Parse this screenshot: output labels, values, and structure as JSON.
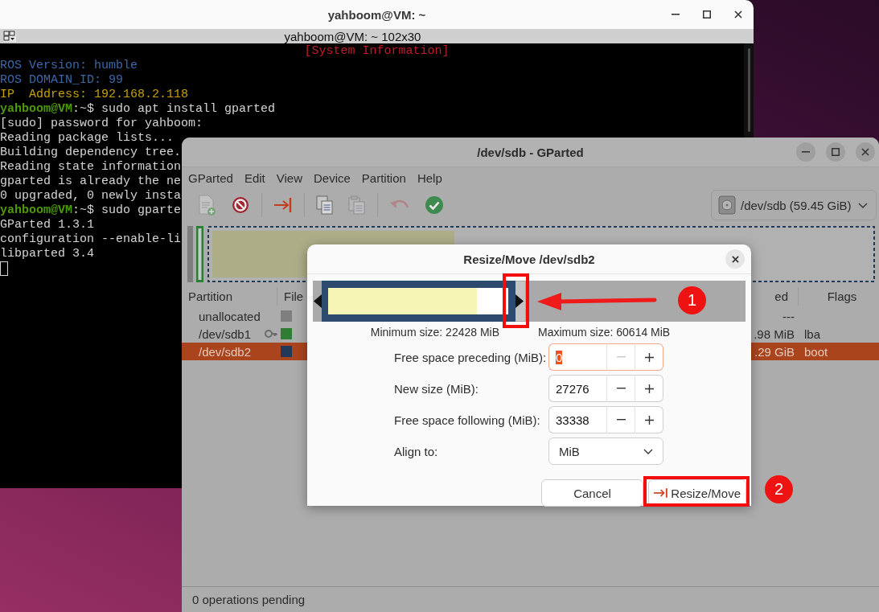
{
  "terminal": {
    "title": "yahboom@VM: ~",
    "tab_title": "yahboom@VM: ~ 102x30",
    "banner": "[System Information]",
    "cursor": true,
    "lines": [
      {
        "segments": [
          {
            "kind": "info",
            "text": "ROS Version: humble"
          }
        ]
      },
      {
        "segments": [
          {
            "kind": "info",
            "text": "ROS DOMAIN_ID: 99"
          }
        ]
      },
      {
        "segments": [
          {
            "kind": "address",
            "text": "IP  Address: 192.168.2.118"
          }
        ]
      },
      {
        "segments": [
          {
            "kind": "user",
            "text": "yahboom@VM"
          },
          {
            "kind": "plain",
            "text": ":~$ sudo apt install gparted"
          }
        ]
      },
      {
        "segments": [
          {
            "kind": "plain",
            "text": "[sudo] password for yahboom:"
          }
        ]
      },
      {
        "segments": [
          {
            "kind": "plain",
            "text": "Reading package lists..."
          }
        ]
      },
      {
        "segments": [
          {
            "kind": "plain",
            "text": "Building dependency tree."
          }
        ]
      },
      {
        "segments": [
          {
            "kind": "plain",
            "text": "Reading state information"
          }
        ]
      },
      {
        "segments": [
          {
            "kind": "plain",
            "text": "gparted is already the ne"
          }
        ]
      },
      {
        "segments": [
          {
            "kind": "plain",
            "text": "0 upgraded, 0 newly insta"
          }
        ]
      },
      {
        "segments": [
          {
            "kind": "user",
            "text": "yahboom@VM"
          },
          {
            "kind": "plain",
            "text": ":~$ sudo gparte"
          }
        ]
      },
      {
        "segments": [
          {
            "kind": "plain",
            "text": "GParted 1.3.1"
          }
        ]
      },
      {
        "segments": [
          {
            "kind": "plain",
            "text": "configuration --enable-li"
          }
        ]
      },
      {
        "segments": [
          {
            "kind": "plain",
            "text": "libparted 3.4"
          }
        ]
      }
    ]
  },
  "gparted": {
    "title": "/dev/sdb - GParted",
    "menu": [
      "GParted",
      "Edit",
      "View",
      "Device",
      "Partition",
      "Help"
    ],
    "toolbar": [
      {
        "kind": "new",
        "disabled": true
      },
      {
        "kind": "delete",
        "disabled": false
      },
      {
        "kind": "separator"
      },
      {
        "kind": "resize",
        "disabled": false
      },
      {
        "kind": "separator"
      },
      {
        "kind": "copy",
        "disabled": false
      },
      {
        "kind": "paste",
        "disabled": true
      },
      {
        "kind": "separator"
      },
      {
        "kind": "undo",
        "disabled": true
      },
      {
        "kind": "apply",
        "disabled": false
      }
    ],
    "device": "/dev/sdb (59.45 GiB)",
    "table": {
      "columns": [
        {
          "label": "Partition"
        },
        {
          "label": "File"
        },
        {
          "label": "ed"
        },
        {
          "label": "Flags"
        }
      ],
      "rows": [
        {
          "partition": "unallocated",
          "locked": false,
          "color": "#7f7f7f",
          "column_3": "---",
          "selected": false
        },
        {
          "partition": "/dev/sdb1",
          "locked": true,
          "color": "#2f7d32",
          "column_3": ".98 MiB",
          "flags": "lba",
          "selected": false
        },
        {
          "partition": "/dev/sdb2",
          "locked": false,
          "color": "#23395a",
          "column_3": ".29 GiB",
          "flags": "boot",
          "selected": true
        }
      ]
    },
    "status_bar": "0 operations pending"
  },
  "dialog": {
    "title": "Resize/Move /dev/sdb2",
    "minimum": "Minimum size: 22428 MiB",
    "maximum": "Maximum size: 60614 MiB",
    "fields": [
      {
        "kind": "spin",
        "label": "Free space preceding (MiB):",
        "value": "0",
        "focused": true,
        "decrement_disabled": true
      },
      {
        "kind": "spin",
        "label": "New size (MiB):",
        "value": "27276",
        "focused": false,
        "decrement_disabled": false
      },
      {
        "kind": "spin",
        "label": "Free space following (MiB):",
        "value": "33338",
        "focused": false,
        "decrement_disabled": false
      },
      {
        "kind": "dropdown",
        "label": "Align to:",
        "value": "MiB"
      }
    ],
    "buttons": [
      {
        "kind": "cancel",
        "label": "Cancel"
      },
      {
        "kind": "resize",
        "label": "Resize/Move"
      }
    ]
  },
  "annotations": {
    "graph_highlight": true,
    "graph_arrow": true,
    "graph_marker": "1",
    "button_highlight": true,
    "button_marker": "2"
  }
}
